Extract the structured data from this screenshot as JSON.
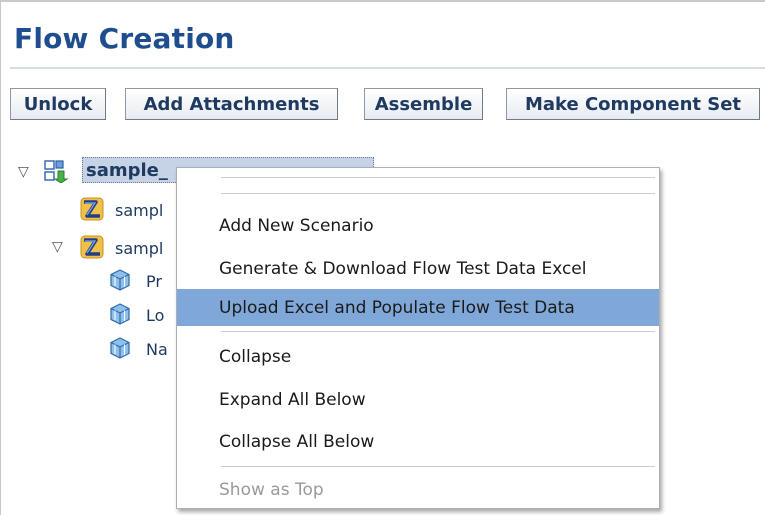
{
  "page": {
    "title": "Flow Creation"
  },
  "toolbar": {
    "unlock": "Unlock",
    "add_attachments": "Add Attachments",
    "assemble": "Assemble",
    "make_component_set": "Make Component Set"
  },
  "tree": {
    "root": {
      "label": "sample_",
      "icon": "flow-icon",
      "expanded": true,
      "selected": true
    },
    "child1": {
      "label": "sampl",
      "icon": "scenario-icon"
    },
    "child2": {
      "label": "sampl",
      "icon": "scenario-icon",
      "expanded": true
    },
    "components": [
      {
        "label": "Pr",
        "icon": "component-cube-icon"
      },
      {
        "label": "Lo",
        "icon": "component-cube-icon"
      },
      {
        "label": "Na",
        "icon": "component-cube-icon"
      }
    ]
  },
  "context_menu": {
    "items": [
      {
        "label": "Add New Scenario",
        "state": "normal"
      },
      {
        "label": "Generate & Download Flow Test Data Excel",
        "state": "normal"
      },
      {
        "label": "Upload Excel and Populate Flow Test Data",
        "state": "highlighted"
      },
      {
        "label": "Collapse",
        "state": "normal"
      },
      {
        "label": "Expand All Below",
        "state": "normal"
      },
      {
        "label": "Collapse All Below",
        "state": "normal"
      },
      {
        "label": "Show as Top",
        "state": "disabled"
      }
    ]
  },
  "colors": {
    "title": "#1f4e8f",
    "selection": "#c6d2e6",
    "menu_highlight": "#7fa8d9",
    "disabled_text": "#9a9a9a"
  }
}
